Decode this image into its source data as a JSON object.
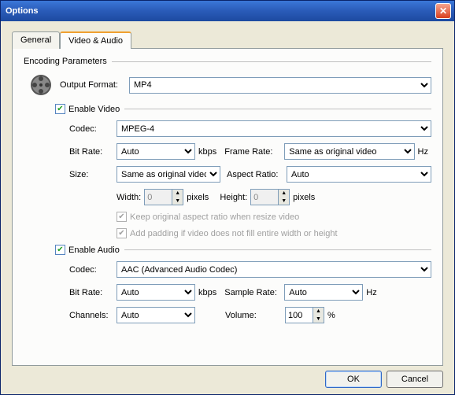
{
  "window": {
    "title": "Options"
  },
  "tabs": {
    "general": "General",
    "videoaudio": "Video & Audio"
  },
  "group": {
    "encoding": "Encoding Parameters"
  },
  "output": {
    "label": "Output Format:",
    "value": "MP4"
  },
  "video": {
    "enable": "Enable Video",
    "codec_label": "Codec:",
    "codec_value": "MPEG-4",
    "bitrate_label": "Bit Rate:",
    "bitrate_value": "Auto",
    "bitrate_unit": "kbps",
    "framerate_label": "Frame Rate:",
    "framerate_value": "Same as original video",
    "framerate_unit": "Hz",
    "size_label": "Size:",
    "size_value": "Same as original video",
    "aspect_label": "Aspect Ratio:",
    "aspect_value": "Auto",
    "width_label": "Width:",
    "width_value": "0",
    "height_label": "Height:",
    "height_value": "0",
    "pixels": "pixels",
    "keepaspect": "Keep original aspect ratio when resize video",
    "addpadding": "Add padding if video does not fill entire width or height"
  },
  "audio": {
    "enable": "Enable Audio",
    "codec_label": "Codec:",
    "codec_value": "AAC (Advanced Audio Codec)",
    "bitrate_label": "Bit Rate:",
    "bitrate_value": "Auto",
    "bitrate_unit": "kbps",
    "samplerate_label": "Sample Rate:",
    "samplerate_value": "Auto",
    "samplerate_unit": "Hz",
    "channels_label": "Channels:",
    "channels_value": "Auto",
    "volume_label": "Volume:",
    "volume_value": "100",
    "volume_unit": "%"
  },
  "buttons": {
    "ok": "OK",
    "cancel": "Cancel"
  }
}
